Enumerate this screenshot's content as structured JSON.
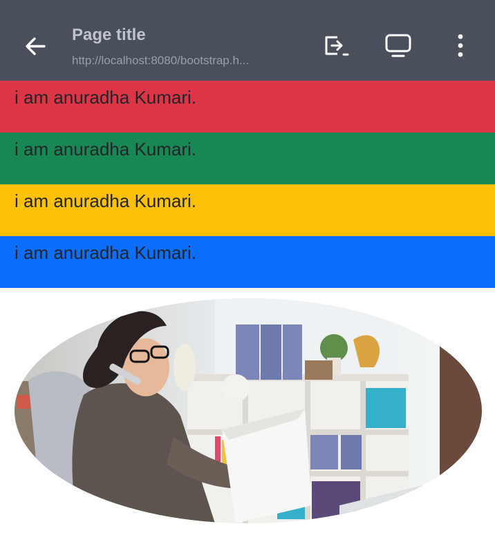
{
  "appbar": {
    "title": "Page title",
    "url": "http://localhost:8080/bootstrap.h..."
  },
  "icons": {
    "back": "arrow-back-icon",
    "share": "share-icon",
    "desktop": "desktop-icon",
    "more": "more-vert-icon"
  },
  "bands": [
    {
      "text": "i am anuradha Kumari.",
      "color": "#dc3545"
    },
    {
      "text": "i am anuradha Kumari.",
      "color": "#198754"
    },
    {
      "text": "i am anuradha Kumari.",
      "color": "#ffc107"
    },
    {
      "text": "i am anuradha Kumari.",
      "color": "#0d6efd"
    }
  ],
  "image": {
    "shape": "ellipse",
    "subject": "photo-woman-on-phone-reading-papers-in-office"
  }
}
